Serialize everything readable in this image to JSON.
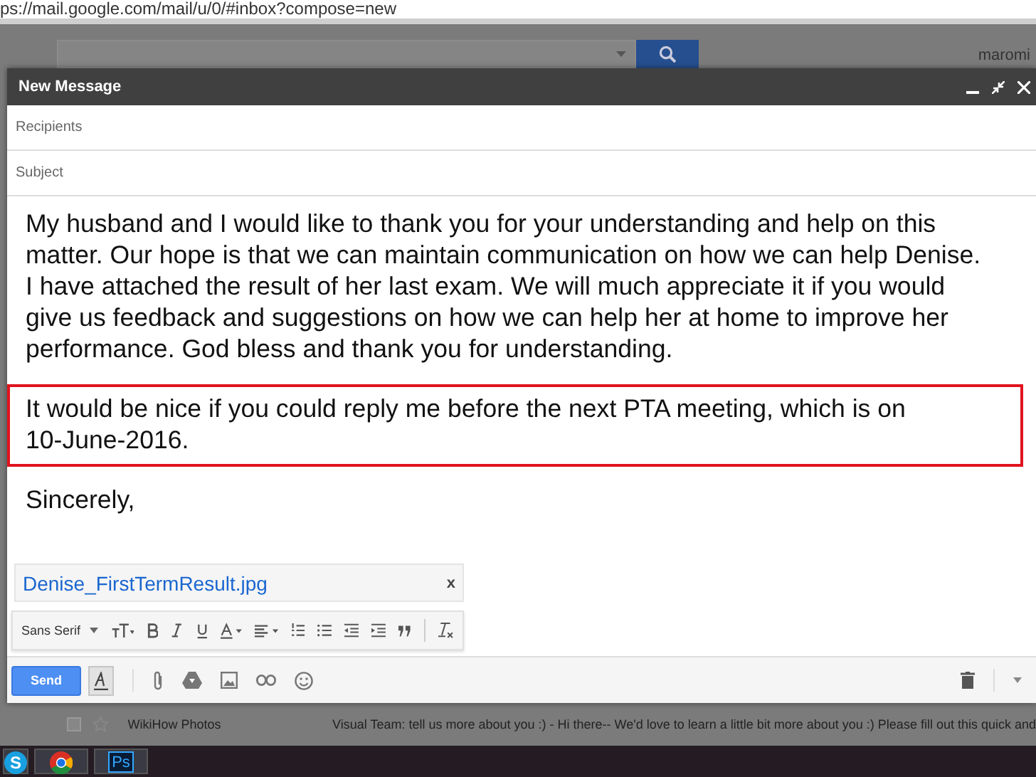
{
  "address_bar": {
    "url": "ps://mail.google.com/mail/u/0/#inbox?compose=new"
  },
  "header": {
    "account": "maromi"
  },
  "compose": {
    "title": "New Message",
    "recipients": {
      "placeholder": "Recipients"
    },
    "subject": {
      "placeholder": "Subject"
    },
    "body": [
      {
        "text": "My husband and I would like to thank you for your understanding and help on this matter.  Our hope is that we can maintain communication on how we can help Denise. I have attached the result of her last exam.  We will much appreciate it if you would give us feedback and suggestions on how we can help her at home to improve her performance. God bless and thank you for understanding.",
        "highlighted": false
      },
      {
        "text": "It would be nice if you could reply me before the next PTA meeting, which is on 10-June-2016.",
        "highlighted": true
      },
      {
        "text": "Sincerely,",
        "highlighted": false
      }
    ],
    "attachment": {
      "name": "Denise_FirstTermResult.jpg",
      "close": "x"
    },
    "font": "Sans Serif",
    "send": "Send",
    "formatting_on": true
  },
  "inbox_row": {
    "sender": "WikiHow Photos",
    "snippet": "Visual Team: tell us more about you :) - Hi there-- We'd love to learn a little bit more about you :) Please fill out this quick and",
    "starred": false,
    "checked": false
  },
  "taskbar": [
    {
      "kind": "skype",
      "label": "S"
    },
    {
      "kind": "chrome"
    },
    {
      "kind": "photoshop",
      "label": "Ps"
    }
  ]
}
